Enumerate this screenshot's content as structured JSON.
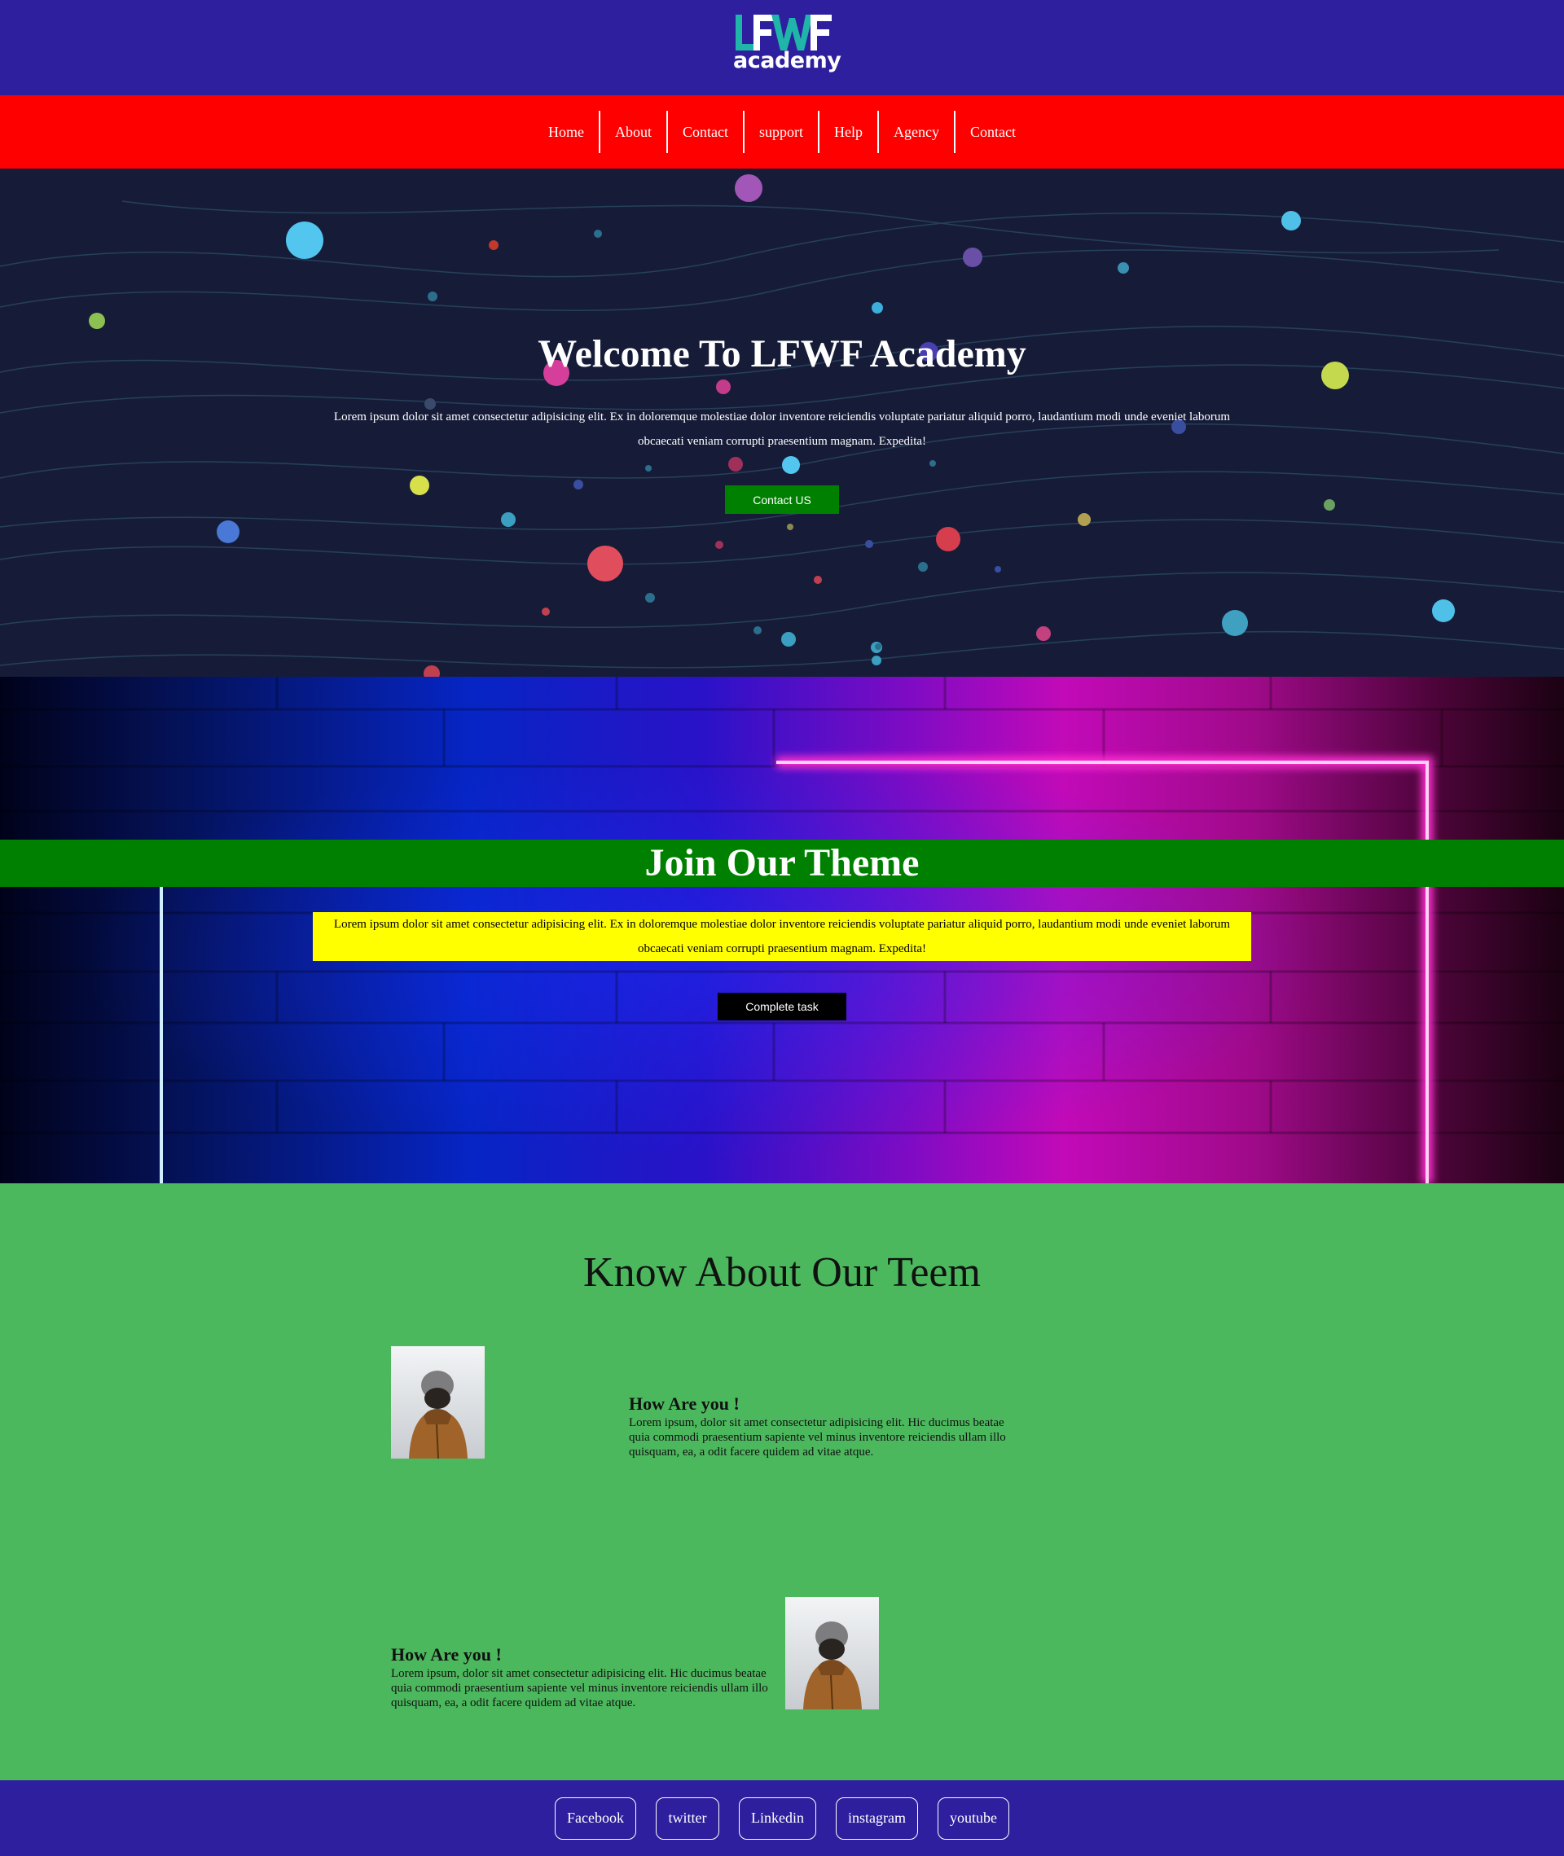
{
  "header": {
    "logo_text_main": "LFWF",
    "logo_text_sub": "academy",
    "background": "#2e1f9e"
  },
  "nav": {
    "background": "#ff0000",
    "items": [
      "Home",
      "About",
      "Contact",
      "support",
      "Help",
      "Agency",
      "Contact"
    ]
  },
  "hero": {
    "title": "Welcome To LFWF Academy",
    "text": "Lorem ipsum dolor sit amet consectetur adipisicing elit. Ex in doloremque molestiae dolor inventore reiciendis voluptate pariatur aliquid porro, laudantium modi unde eveniet laborum obcaecati veniam corrupti praesentium magnam. Expedita!",
    "button_label": "Contact US"
  },
  "join": {
    "title": "Join Our Theme",
    "text": "Lorem ipsum dolor sit amet consectetur adipisicing elit. Ex in doloremque molestiae dolor inventore reiciendis voluptate pariatur aliquid porro, laudantium modi unde eveniet laborum obcaecati veniam corrupti praesentium magnam. Expedita!",
    "button_label": "Complete task"
  },
  "team": {
    "title": "Know About Our Teem",
    "members": [
      {
        "heading": "How Are you !",
        "text": "Lorem ipsum, dolor sit amet consectetur adipisicing elit. Hic ducimus beatae quia commodi praesentium sapiente vel minus inventore reiciendis ullam illo quisquam, ea, a odit facere quidem ad vitae atque."
      },
      {
        "heading": "How Are you !",
        "text": "Lorem ipsum, dolor sit amet consectetur adipisicing elit. Hic ducimus beatae quia commodi praesentium sapiente vel minus inventore reiciendis ullam illo quisquam, ea, a odit facere quidem ad vitae atque."
      }
    ]
  },
  "footer": {
    "links": [
      "Facebook",
      "twitter",
      "Linkedin",
      "instagram",
      "youtube"
    ]
  }
}
